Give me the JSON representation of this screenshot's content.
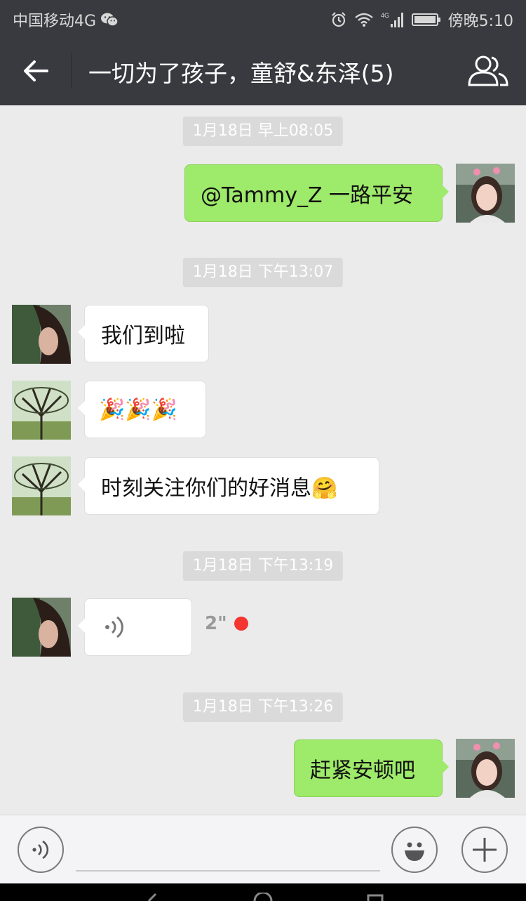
{
  "status_bar": {
    "carrier": "中国移动4G",
    "time": "傍晚5:10",
    "network": "4G"
  },
  "header": {
    "title": "一切为了孩子，童舒&东泽(5)"
  },
  "messages": [
    {
      "timestamp": "1月18日 早上08:05"
    },
    {
      "text": "@Tammy_Z  一路平安"
    },
    {
      "timestamp": "1月18日 下午13:07"
    },
    {
      "text": "我们到啦"
    },
    {
      "text": "🎉🎉🎉"
    },
    {
      "text": "时刻关注你们的好消息🤗"
    },
    {
      "timestamp": "1月18日 下午13:19"
    },
    {
      "voice_duration": "2\""
    },
    {
      "timestamp": "1月18日 下午13:26"
    },
    {
      "text": "赶紧安顿吧"
    }
  ],
  "input_bar": {
    "placeholder": ""
  },
  "colors": {
    "header_bg": "#393a3f",
    "chat_bg": "#ebebeb",
    "outgoing_bubble": "#9eea6a",
    "incoming_bubble": "#ffffff",
    "unread_dot": "#f43530"
  }
}
